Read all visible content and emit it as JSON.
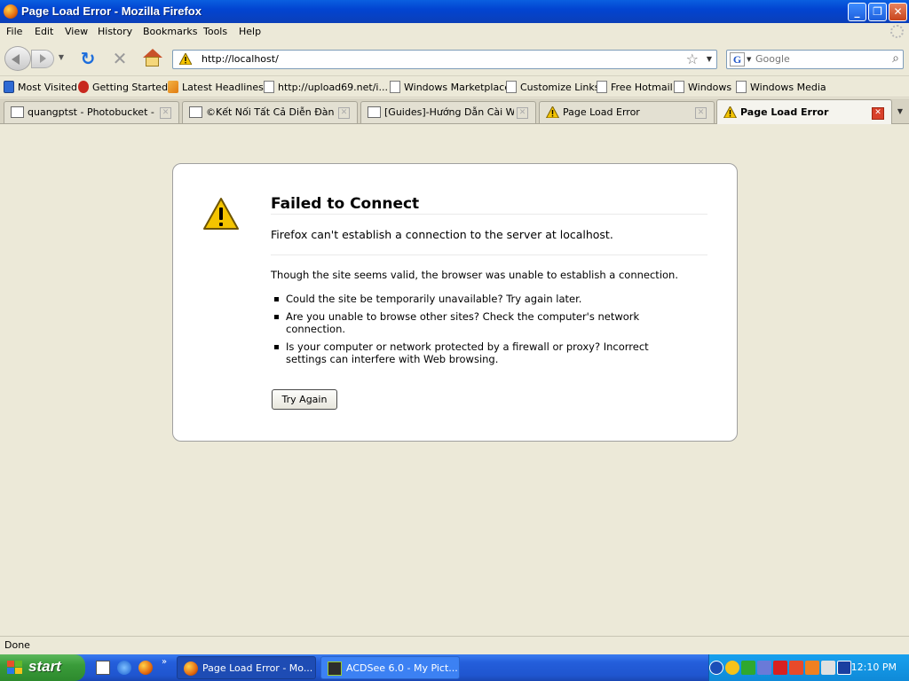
{
  "window": {
    "title": "Page Load Error - Mozilla Firefox"
  },
  "menu": [
    "File",
    "Edit",
    "View",
    "History",
    "Bookmarks",
    "Tools",
    "Help"
  ],
  "address": {
    "url": "http://localhost/"
  },
  "search": {
    "placeholder": "Google",
    "engine_letter": "G"
  },
  "bookmarks": [
    {
      "label": "Most Visited",
      "icon": "most-visited-icon"
    },
    {
      "label": "Getting Started",
      "icon": "firefox-icon"
    },
    {
      "label": "Latest Headlines",
      "icon": "rss-icon"
    },
    {
      "label": "http://upload69.net/i...",
      "icon": "page-icon"
    },
    {
      "label": "Windows Marketplace",
      "icon": "page-icon"
    },
    {
      "label": "Customize Links",
      "icon": "page-icon"
    },
    {
      "label": "Free Hotmail",
      "icon": "page-icon"
    },
    {
      "label": "Windows",
      "icon": "page-icon"
    },
    {
      "label": "Windows Media",
      "icon": "page-icon"
    }
  ],
  "tabs": [
    {
      "label": "quangptst - Photobucket - Vi...",
      "active": false
    },
    {
      "label": "©Kết Nối Tất Cả Diễn Đàn™ ...",
      "active": false
    },
    {
      "label": "[Guides]-Hướng Dẫn Cài We...",
      "active": false
    },
    {
      "label": "Page Load Error",
      "active": false
    },
    {
      "label": "Page Load Error",
      "active": true
    }
  ],
  "error": {
    "title": "Failed to Connect",
    "subtitle": "Firefox can't establish a connection to the server at localhost.",
    "description": "Though the site seems valid, the browser was unable to establish a connection.",
    "items": [
      "Could the site be temporarily unavailable? Try again later.",
      "Are you unable to browse other sites? Check the computer's network connection.",
      "Is your computer or network protected by a firewall or proxy? Incorrect settings can interfere with Web browsing."
    ],
    "button": "Try Again"
  },
  "status": "Done",
  "taskbar": {
    "start_label": "start",
    "quick_launch_more": "»",
    "buttons": [
      {
        "label": "Page Load Error - Mo...",
        "active": true
      },
      {
        "label": "ACDSee 6.0 - My Pict...",
        "active": false
      }
    ],
    "clock": "12:10 PM"
  },
  "colors": {
    "titlebar": "#0244d1",
    "chrome": "#ece9d8",
    "warning": "#f4c400",
    "close_red": "#d8402a"
  }
}
